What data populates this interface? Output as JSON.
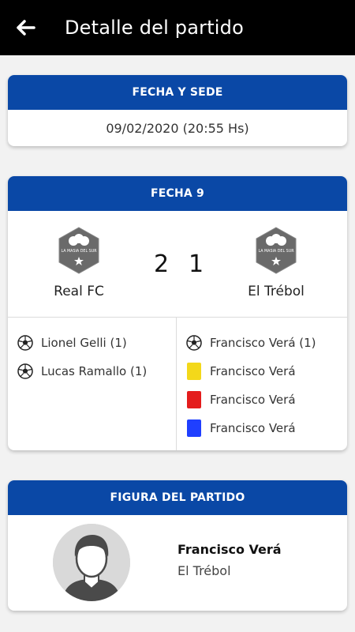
{
  "appbar": {
    "title": "Detalle del partido",
    "back_icon": "arrow-left-icon"
  },
  "fecha_sede": {
    "header": "FECHA Y SEDE",
    "value": "09/02/2020 (20:55 Hs)"
  },
  "match": {
    "header": "FECHA 9",
    "home": {
      "name": "Real FC",
      "score": "2",
      "badge_text": "LA MASIA DEL SUR"
    },
    "away": {
      "name": "El Trébol",
      "score": "1",
      "badge_text": "LA MASIA DEL SUR"
    },
    "home_events": [
      {
        "icon": "soccer-ball-icon",
        "text": "Lionel Gelli (1)"
      },
      {
        "icon": "soccer-ball-icon",
        "text": "Lucas Ramallo (1)"
      }
    ],
    "away_events": [
      {
        "icon": "soccer-ball-icon",
        "text": "Francisco Verá (1)"
      },
      {
        "icon": "yellow-card-icon",
        "text": "Francisco Verá"
      },
      {
        "icon": "red-card-icon",
        "text": "Francisco Verá"
      },
      {
        "icon": "blue-card-icon",
        "text": "Francisco Verá"
      }
    ]
  },
  "figura": {
    "header": "FIGURA DEL PARTIDO",
    "name": "Francisco Verá",
    "team": "El Trébol"
  },
  "colors": {
    "appbar": "#000000",
    "header_blue": "#0a48a6",
    "yellow_card": "#f3d81a",
    "red_card": "#e41c1c",
    "blue_card": "#1f3fff"
  }
}
